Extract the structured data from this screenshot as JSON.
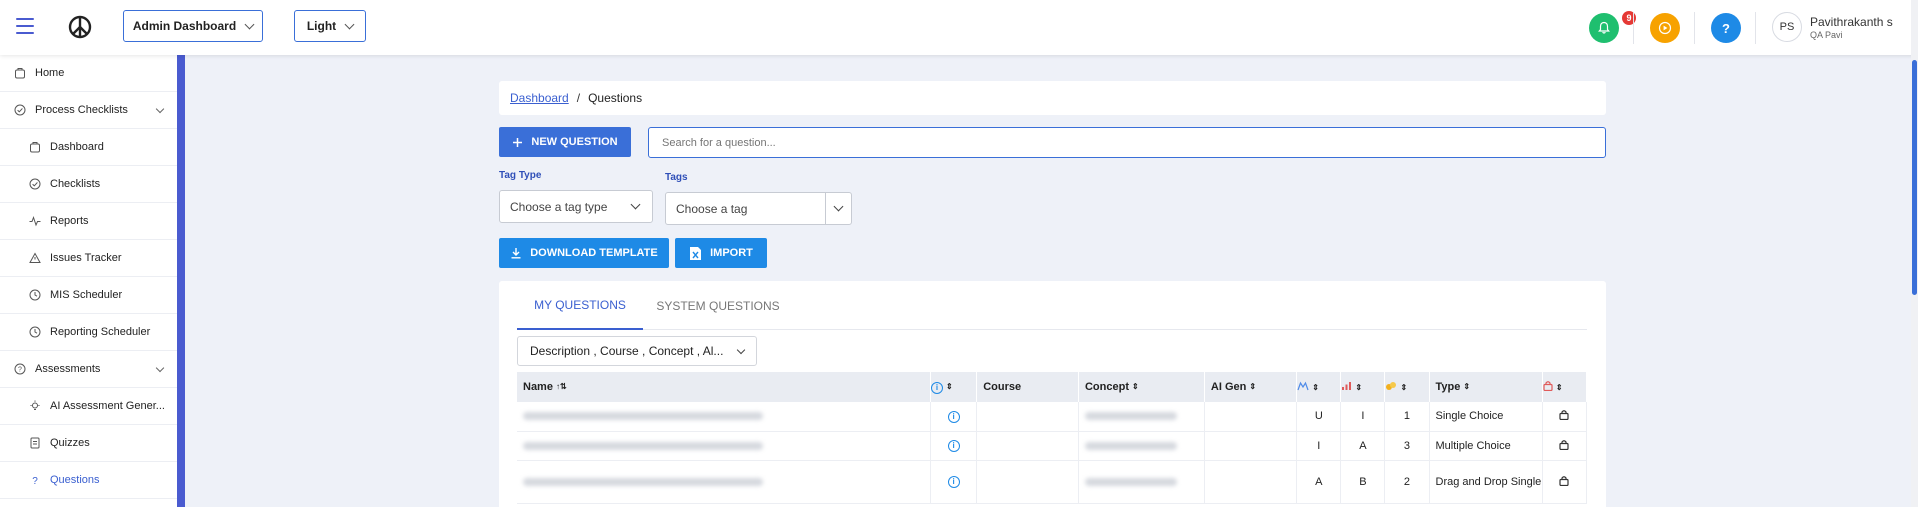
{
  "header": {
    "dashboard_select": "Admin Dashboard",
    "theme_select": "Light",
    "notification_count": "9",
    "help_label": "?",
    "user_initials": "PS",
    "user_name": "Pavithrakanth s",
    "user_org": "QA Pavi",
    "colors": {
      "notification": "#1fbf6f",
      "video": "#f7a200",
      "help": "#1e8ae6"
    }
  },
  "sidebar": {
    "items": [
      {
        "label": "Home",
        "icon": "home-icon",
        "level": "top"
      },
      {
        "label": "Process Checklists",
        "icon": "check-circle-icon",
        "level": "top",
        "expandable": true
      },
      {
        "label": "Dashboard",
        "icon": "home-icon",
        "level": "sub"
      },
      {
        "label": "Checklists",
        "icon": "check-circle-icon",
        "level": "sub"
      },
      {
        "label": "Reports",
        "icon": "activity-icon",
        "level": "sub"
      },
      {
        "label": "Issues Tracker",
        "icon": "warning-icon",
        "level": "sub"
      },
      {
        "label": "MIS Scheduler",
        "icon": "clock-icon",
        "level": "sub"
      },
      {
        "label": "Reporting Scheduler",
        "icon": "clock-icon",
        "level": "sub"
      },
      {
        "label": "Assessments",
        "icon": "question-circle-icon",
        "level": "top",
        "expandable": true
      },
      {
        "label": "AI Assessment Gener...",
        "icon": "lightbulb-icon",
        "level": "sub"
      },
      {
        "label": "Quizzes",
        "icon": "document-icon",
        "level": "sub"
      },
      {
        "label": "Questions",
        "icon": "question-icon",
        "level": "sub",
        "active": true
      }
    ]
  },
  "breadcrumb": {
    "root": "Dashboard",
    "separator": "/",
    "current": "Questions"
  },
  "toolbar": {
    "new_question": "NEW QUESTION",
    "search_placeholder": "Search for a question...",
    "download_template": "DOWNLOAD TEMPLATE",
    "import": "IMPORT"
  },
  "filters": {
    "tag_type_label": "Tag Type",
    "tag_type_value": "Choose a tag type",
    "tags_label": "Tags",
    "tags_value": "Choose a tag"
  },
  "tabs": [
    "MY QUESTIONS",
    "SYSTEM QUESTIONS"
  ],
  "column_filter": "Description , Course , Concept , Al...",
  "table": {
    "headers": {
      "name": "Name",
      "course": "Course",
      "concept": "Concept",
      "ai_gen": "AI Gen",
      "type": "Type"
    },
    "rows": [
      {
        "col1": "U",
        "col2": "I",
        "col3": "1",
        "type": "Single Choice"
      },
      {
        "col1": "I",
        "col2": "A",
        "col3": "3",
        "type": "Multiple Choice"
      },
      {
        "col1": "A",
        "col2": "B",
        "col3": "2",
        "type": "Drag and Drop Single"
      }
    ]
  }
}
